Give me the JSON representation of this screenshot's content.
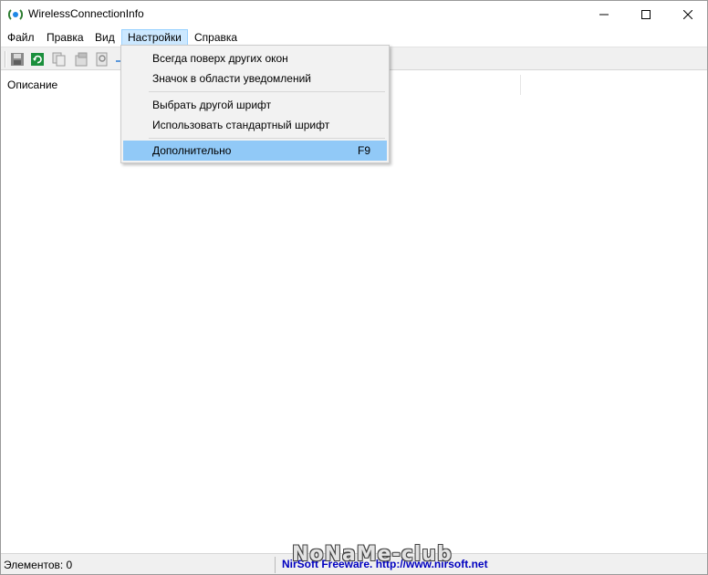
{
  "window": {
    "title": "WirelessConnectionInfo",
    "icon": "wireless-app-icon"
  },
  "menubar": {
    "items": [
      {
        "label": "Файл"
      },
      {
        "label": "Правка"
      },
      {
        "label": "Вид"
      },
      {
        "label": "Настройки",
        "active": true
      },
      {
        "label": "Справка"
      }
    ]
  },
  "toolbar": {
    "icons": [
      "save-icon",
      "refresh-icon",
      "copy-icon",
      "properties-icon",
      "find-icon",
      "separator-icon"
    ]
  },
  "dropdown": {
    "items": [
      {
        "label": "Всегда поверх других окон"
      },
      {
        "label": "Значок в области уведомлений"
      },
      {
        "label": "Выбрать другой шрифт"
      },
      {
        "label": "Использовать стандартный шрифт"
      },
      {
        "label": "Дополнительно",
        "shortcut": "F9",
        "highlighted": true
      }
    ]
  },
  "listview": {
    "columns": [
      "Описание"
    ]
  },
  "statusbar": {
    "count": "Элементов: 0",
    "link": "NirSoft Freeware.  http://www.nirsoft.net"
  },
  "watermark": "NoNaMe-club",
  "colors": {
    "menu_active_bg": "#cce8ff",
    "dropdown_highlight": "#91c9f7",
    "link": "#0000c0"
  }
}
